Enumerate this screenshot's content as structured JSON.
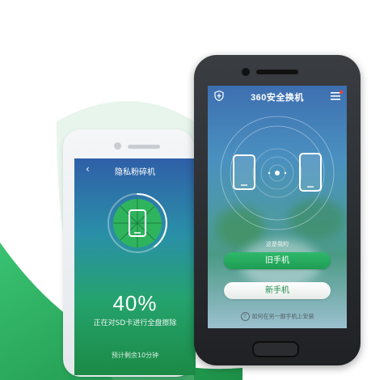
{
  "back_phone": {
    "title": "隐私粉碎机",
    "back_arrow": "‹",
    "progress_percent": 40,
    "progress_text": "40%",
    "status_text": "正在对SD卡进行全盘擦除",
    "remaining_text": "预计剩余10分钟"
  },
  "front_phone": {
    "app_title": "360安全换机",
    "prompt": "这是我的",
    "old_phone_label": "旧手机",
    "new_phone_label": "新手机",
    "help_glyph": "?",
    "help_text": "如何在另一部手机上安装"
  },
  "colors": {
    "accent_green": "#1d9d53",
    "sweep_green": "#1aa054",
    "screen_blue": "#3e6fb0",
    "notification_red": "#ff3b30"
  },
  "icons": {
    "shield": "shield-icon",
    "menu": "menu-icon",
    "phone_outline": "phone-icon",
    "shred": "shred-icon",
    "help": "help-icon"
  }
}
